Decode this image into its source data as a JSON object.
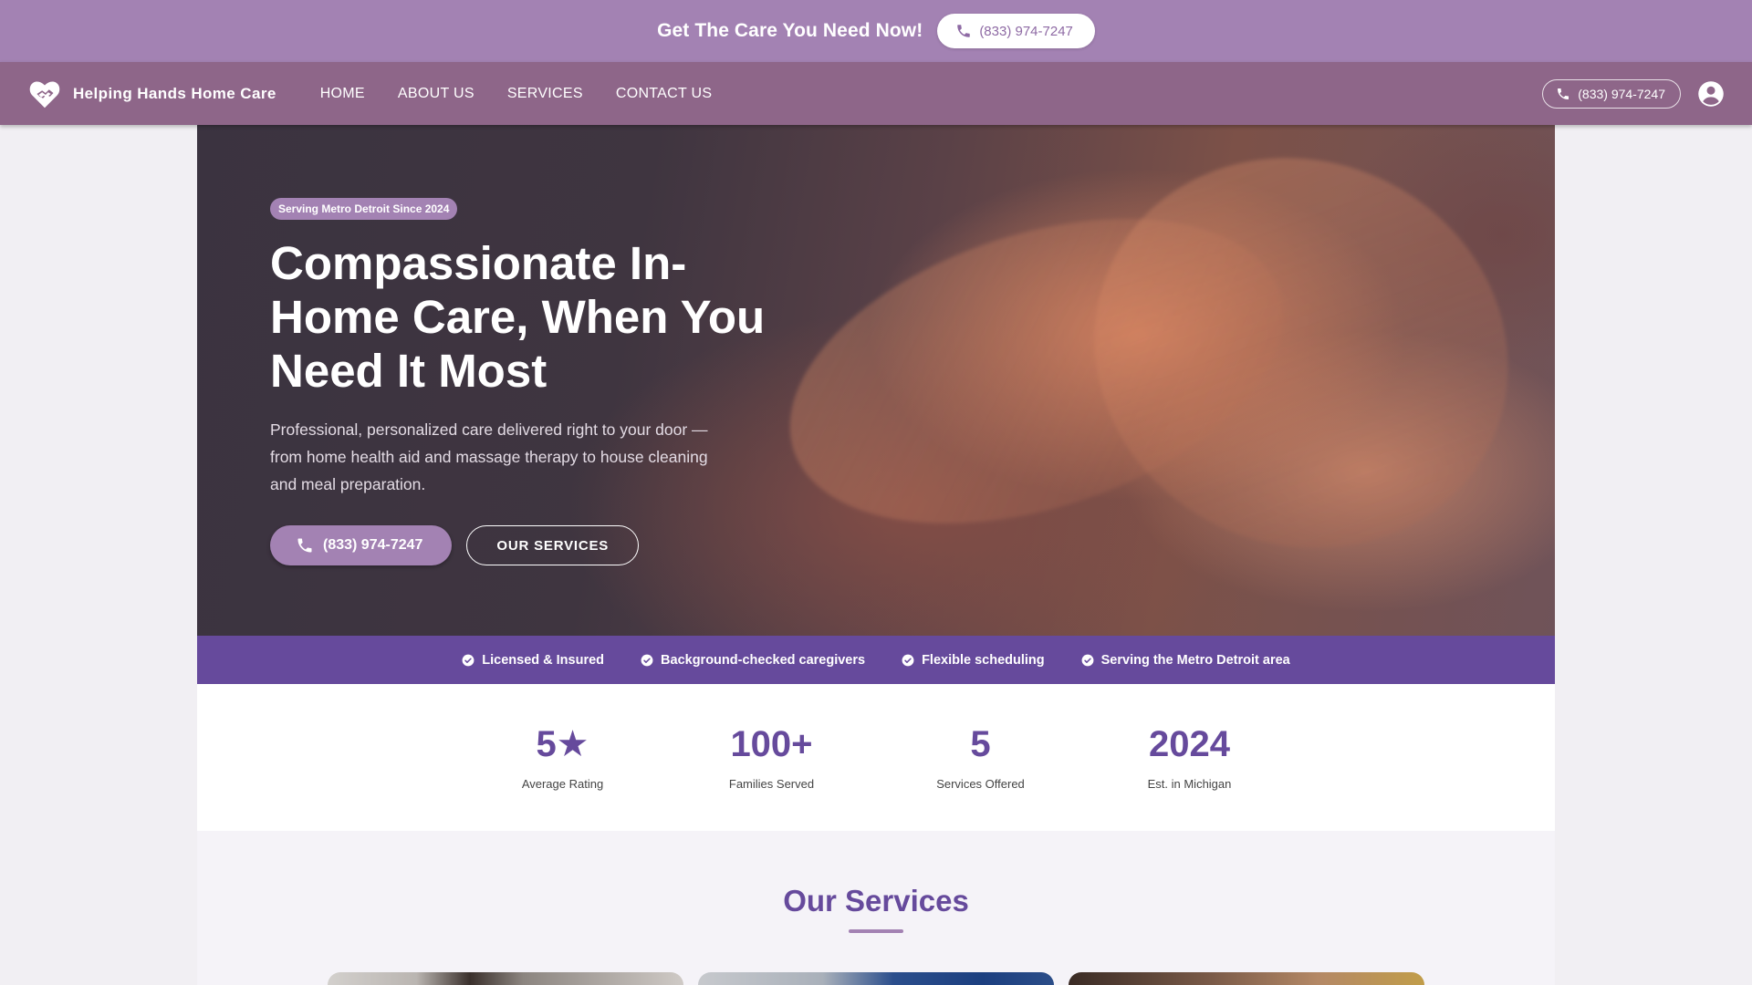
{
  "promo": {
    "text": "Get The Care You Need Now!",
    "phone": "(833) 974-7247"
  },
  "nav": {
    "brand": "Helping Hands Home Care",
    "links": [
      "HOME",
      "ABOUT US",
      "SERVICES",
      "CONTACT US"
    ],
    "phone": "(833) 974-7247"
  },
  "hero": {
    "badge": "Serving Metro Detroit Since 2024",
    "title": "Compassionate In-Home Care, When You Need It Most",
    "description": "Professional, personalized care delivered right to your door — from home health aid and massage therapy to house cleaning and meal preparation.",
    "primary_button": "(833) 974-7247",
    "secondary_button": "OUR SERVICES"
  },
  "trust": [
    "Licensed & Insured",
    "Background-checked caregivers",
    "Flexible scheduling",
    "Serving the Metro Detroit area"
  ],
  "stats": [
    {
      "value": "5★",
      "label": "Average Rating"
    },
    {
      "value": "100+",
      "label": "Families Served"
    },
    {
      "value": "5",
      "label": "Services Offered"
    },
    {
      "value": "2024",
      "label": "Est. in Michigan"
    }
  ],
  "services": {
    "title": "Our Services"
  },
  "colors": {
    "promo_bg": "#a382b3",
    "nav_bg": "#8e6689",
    "accent": "#664a9c",
    "button_bg": "#a382b3"
  },
  "icons": {
    "phone": "phone-icon",
    "brand": "heart-hands-icon",
    "account": "account-circle-icon",
    "check": "check-circle-icon"
  }
}
